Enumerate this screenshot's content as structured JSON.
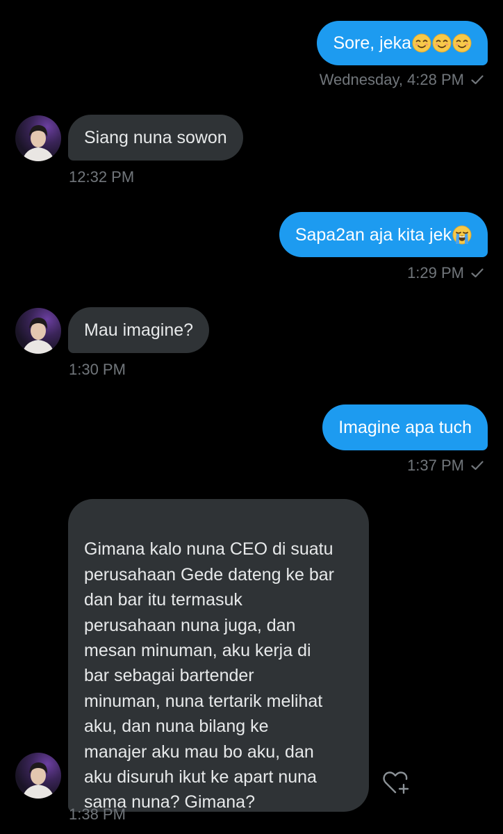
{
  "colors": {
    "background": "#000000",
    "outgoing_bubble": "#1d9bf0",
    "incoming_bubble": "#2f3336",
    "meta_text": "#71767b"
  },
  "messages": [
    {
      "direction": "outgoing",
      "text": "Sore, jeka",
      "emoji": [
        "smiling-face-icon",
        "smiling-face-icon",
        "smiling-face-icon"
      ],
      "time": "Wednesday, 4:28 PM",
      "status": "sent"
    },
    {
      "direction": "incoming",
      "text": "Siang nuna sowon",
      "time": "12:32 PM"
    },
    {
      "direction": "outgoing",
      "text": "Sapa2an aja kita jek",
      "emoji": [
        "loudly-crying-face-icon"
      ],
      "time": "1:29 PM",
      "status": "sent"
    },
    {
      "direction": "incoming",
      "text": "Mau imagine?",
      "time": "1:30 PM"
    },
    {
      "direction": "outgoing",
      "text": "Imagine apa tuch",
      "time": "1:37 PM",
      "status": "sent"
    },
    {
      "direction": "incoming",
      "text": "Gimana kalo nuna CEO di suatu\nperusahaan Gede dateng ke bar\ndan bar itu termasuk\nperusahaan nuna juga, dan\nmesan minuman, aku kerja di\nbar sebagai bartender\nminuman, nuna tertarik melihat\naku, dan nuna bilang ke\nmanajer aku mau bo aku, dan\naku disuruh ikut ke apart nuna\nsama nuna? Gimana?",
      "time": "1:38 PM"
    }
  ]
}
